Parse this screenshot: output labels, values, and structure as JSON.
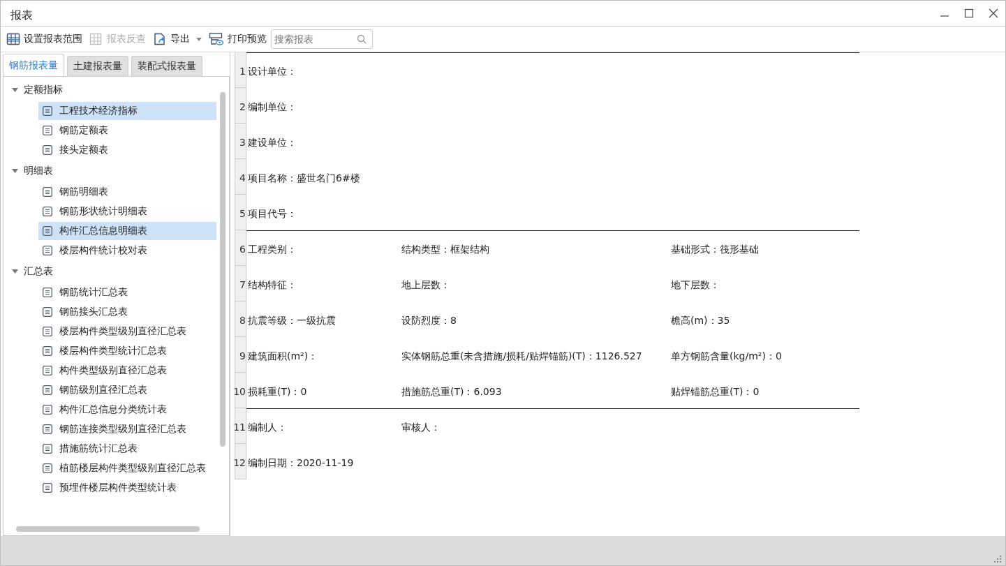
{
  "window": {
    "title": "报表"
  },
  "toolbar": [
    {
      "label": "设置报表范围",
      "kind": "grid",
      "disabled": false,
      "dropdown": false
    },
    {
      "label": "报表反查",
      "kind": "lookup",
      "disabled": true,
      "dropdown": false
    },
    {
      "label": "导出",
      "kind": "export",
      "disabled": false,
      "dropdown": true
    },
    {
      "label": "打印预览",
      "kind": "print",
      "disabled": false,
      "dropdown": false
    }
  ],
  "search": {
    "placeholder": "搜索报表"
  },
  "tabs": [
    {
      "label": "钢筋报表量",
      "selected": true
    },
    {
      "label": "土建报表量",
      "selected": false
    },
    {
      "label": "装配式报表量",
      "selected": false
    }
  ],
  "tree": [
    {
      "label": "定额指标",
      "expanded": true,
      "children": [
        {
          "label": "工程技术经济指标",
          "selected": true
        },
        {
          "label": "钢筋定额表",
          "selected": false
        },
        {
          "label": "接头定额表",
          "selected": false
        }
      ]
    },
    {
      "label": "明细表",
      "expanded": true,
      "children": [
        {
          "label": "钢筋明细表",
          "selected": false
        },
        {
          "label": "钢筋形状统计明细表",
          "selected": false
        },
        {
          "label": "构件汇总信息明细表",
          "selected": true
        },
        {
          "label": "楼层构件统计校对表",
          "selected": false
        }
      ]
    },
    {
      "label": "汇总表",
      "expanded": true,
      "children": [
        {
          "label": "钢筋统计汇总表",
          "selected": false
        },
        {
          "label": "钢筋接头汇总表",
          "selected": false
        },
        {
          "label": "楼层构件类型级别直径汇总表",
          "selected": false
        },
        {
          "label": "楼层构件类型统计汇总表",
          "selected": false
        },
        {
          "label": "构件类型级别直径汇总表",
          "selected": false
        },
        {
          "label": "钢筋级别直径汇总表",
          "selected": false
        },
        {
          "label": "构件汇总信息分类统计表",
          "selected": false
        },
        {
          "label": "钢筋连接类型级别直径汇总表",
          "selected": false
        },
        {
          "label": "措施筋统计汇总表",
          "selected": false
        },
        {
          "label": "植筋楼层构件类型级别直径汇总表",
          "selected": false
        },
        {
          "label": "预埋件楼层构件类型统计表",
          "selected": false
        }
      ]
    }
  ],
  "report": {
    "rows": [
      {
        "number": "1",
        "rule_above": true,
        "cells": [
          "设计单位："
        ]
      },
      {
        "number": "2",
        "rule_above": false,
        "cells": [
          "编制单位："
        ]
      },
      {
        "number": "3",
        "rule_above": false,
        "cells": [
          "建设单位："
        ]
      },
      {
        "number": "4",
        "rule_above": false,
        "cells": [
          "项目名称：盛世名门6#楼"
        ]
      },
      {
        "number": "5",
        "rule_above": false,
        "cells": [
          "项目代号："
        ]
      },
      {
        "number": "6",
        "rule_above": true,
        "cells": [
          "工程类别：",
          "结构类型：框架结构",
          "基础形式：筏形基础"
        ]
      },
      {
        "number": "7",
        "rule_above": false,
        "cells": [
          "结构特征：",
          "地上层数：",
          "地下层数："
        ]
      },
      {
        "number": "8",
        "rule_above": false,
        "cells": [
          "抗震等级：一级抗震",
          "设防烈度：8",
          "檐高(m)：35"
        ]
      },
      {
        "number": "9",
        "rule_above": false,
        "cells": [
          "建筑面积(m²)：",
          "实体钢筋总重(未含措施/损耗/贴焊锚筋)(T)：1126.527",
          "单方钢筋含量(kg/m²)：0"
        ]
      },
      {
        "number": "10",
        "rule_above": false,
        "cells": [
          "损耗重(T)：0",
          "措施筋总重(T)：6.093",
          "贴焊锚筋总重(T)：0"
        ]
      },
      {
        "number": "11",
        "rule_above": true,
        "cells": [
          "编制人：",
          "审核人："
        ]
      },
      {
        "number": "12",
        "rule_above": false,
        "cells": [
          "编制日期：2020-11-19"
        ]
      }
    ]
  }
}
